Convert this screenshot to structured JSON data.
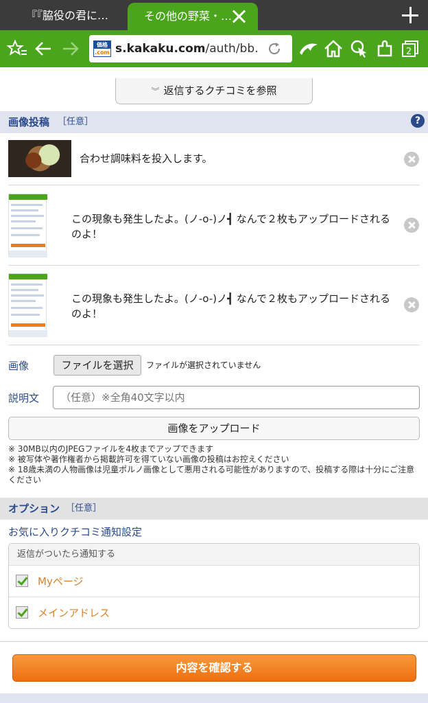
{
  "browser": {
    "tabs": [
      {
        "label": "『『脇役の君に…"
      },
      {
        "label": "その他の野菜・…"
      }
    ],
    "url": {
      "domain": "s.kakaku.com",
      "path": "/auth/bb…"
    },
    "favicon": {
      "top": "価格",
      "bottom": ".com"
    }
  },
  "page": {
    "reply_button": "返信するクチコミを参照",
    "image_section": {
      "title": "画像投稿",
      "optional": "［任意］",
      "help": "?",
      "images": [
        {
          "caption": "合わせ調味料を投入します。"
        },
        {
          "caption": "この現象も発生したよ。(ノ-o-)ノ┫ なんで２枚もアップロードされるのよ！"
        },
        {
          "caption": "この現象も発生したよ。(ノ-o-)ノ┫ なんで２枚もアップロードされるのよ！"
        }
      ],
      "image_label": "画像",
      "file_button": "ファイルを選択",
      "file_status": "ファイルが選択されていません",
      "description_label": "説明文",
      "description_placeholder": "（任意）※全角40文字以内",
      "upload_button": "画像をアップロード",
      "notes": [
        "※ 30MB以内のJPEGファイルを4枚までアップできます",
        "※ 被写体や著作権者から掲載許可を得ていない画像の投稿はお控えください",
        "※ 18歳未満の人物画像は児童ポルノ画像として悪用される可能性がありますので、投稿する際は十分にご注意ください"
      ]
    },
    "option_section": {
      "title": "オプション",
      "optional": "［任意］",
      "favorite_title": "お気に入りクチコミ通知設定",
      "notify_header": "返信がついたら通知する",
      "checkboxes": [
        {
          "label": "Myページ",
          "checked": true
        },
        {
          "label": "メインアドレス",
          "checked": true
        }
      ]
    },
    "confirm_button": "内容を確認する"
  },
  "colors": {
    "brand_green": "#4aa51c",
    "accent_orange": "#ee6f10",
    "link_blue": "#2a4a8c"
  }
}
